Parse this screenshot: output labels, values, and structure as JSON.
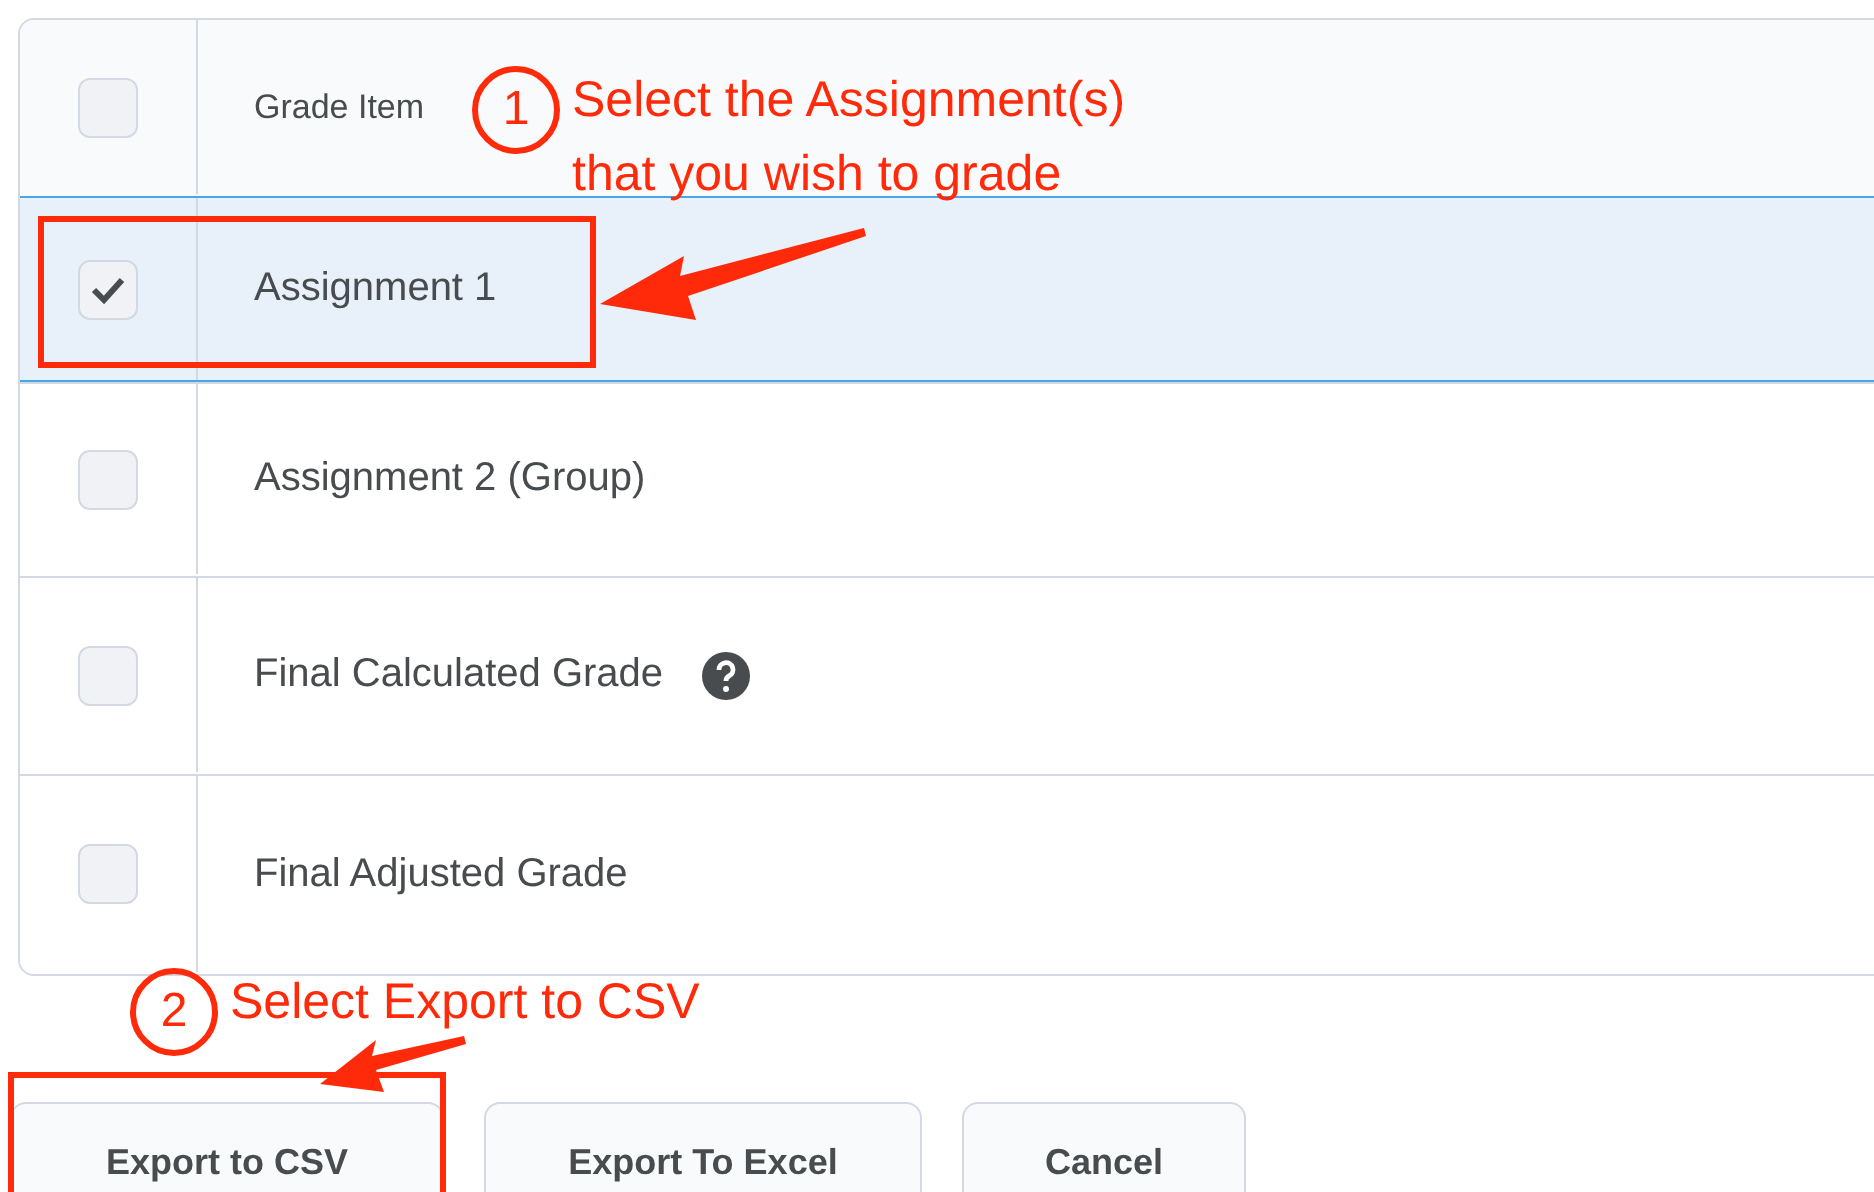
{
  "table": {
    "header": {
      "label": "Grade Item",
      "checked": false
    },
    "rows": [
      {
        "label": "Assignment 1",
        "checked": true,
        "help": false
      },
      {
        "label": "Assignment 2 (Group)",
        "checked": false,
        "help": false
      },
      {
        "label": "Final Calculated Grade",
        "checked": false,
        "help": true
      },
      {
        "label": "Final Adjusted Grade",
        "checked": false,
        "help": false
      }
    ]
  },
  "buttons": [
    {
      "label": "Export to CSV"
    },
    {
      "label": "Export To Excel"
    },
    {
      "label": "Cancel"
    }
  ],
  "annotations": [
    {
      "number": "1",
      "text": "Select the Assignment(s)\nthat you wish to grade"
    },
    {
      "number": "2",
      "text": "Select Export to CSV"
    }
  ]
}
